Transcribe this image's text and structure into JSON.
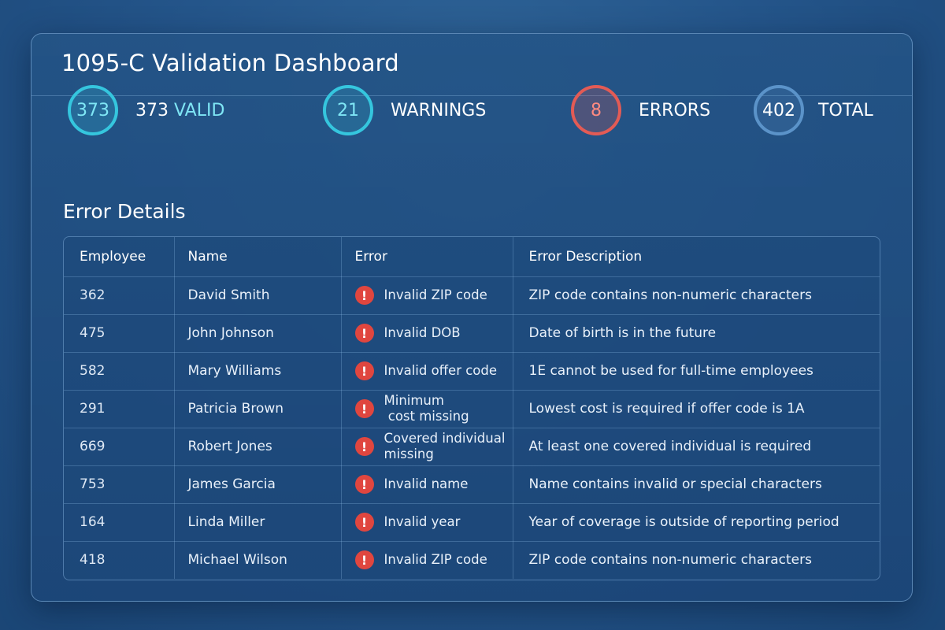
{
  "page_title": "1095-C Validation Dashboard",
  "stats": {
    "valid": {
      "count": "373",
      "label_prefix": "373",
      "label": "VALID",
      "color": "#35c6de"
    },
    "warnings": {
      "count": "21",
      "label": "WARNINGS",
      "color": "#35c6de"
    },
    "errors": {
      "count": "8",
      "label": "ERRORS",
      "color": "#e35b55"
    },
    "total": {
      "count": "402",
      "label": "TOTAL",
      "color": "#5b93c9"
    }
  },
  "error_section": {
    "title": "Error Details",
    "columns": [
      "Employee",
      "Name",
      "Error",
      "Error Description"
    ],
    "rows": [
      {
        "employee": "362",
        "name": "David Smith",
        "error": "Invalid ZIP code",
        "description": "ZIP code contains non-numeric characters",
        "icon": "error-icon"
      },
      {
        "employee": "475",
        "name": "John Johnson",
        "error": "Invalid DOB",
        "description": "Date of birth is in the future",
        "icon": "error-icon"
      },
      {
        "employee": "582",
        "name": "Mary Williams",
        "error": "Invalid offer code",
        "description": "1E cannot be used for full-time employees",
        "icon": "error-icon"
      },
      {
        "employee": "291",
        "name": "Patricia Brown",
        "error": "Minimum\n cost missing",
        "description": "Lowest cost is required if offer code is 1A",
        "icon": "error-icon"
      },
      {
        "employee": "669",
        "name": "Robert Jones",
        "error": "Covered individual\nmissing",
        "description": "At least one covered individual is required",
        "icon": "error-icon"
      },
      {
        "employee": "753",
        "name": "James Garcia",
        "error": "Invalid name",
        "description": "Name contains invalid or special characters",
        "icon": "error-icon"
      },
      {
        "employee": "164",
        "name": "Linda Miller",
        "error": "Invalid year",
        "description": "Year of coverage is outside of reporting period",
        "icon": "error-icon"
      },
      {
        "employee": "418",
        "name": "Michael Wilson",
        "error": "Invalid ZIP code",
        "description": "ZIP code contains non-numeric characters",
        "icon": "error-icon"
      }
    ]
  },
  "colors": {
    "background": "#24558a",
    "error_icon": "#e0463f",
    "accent": "#7fe6f5"
  }
}
